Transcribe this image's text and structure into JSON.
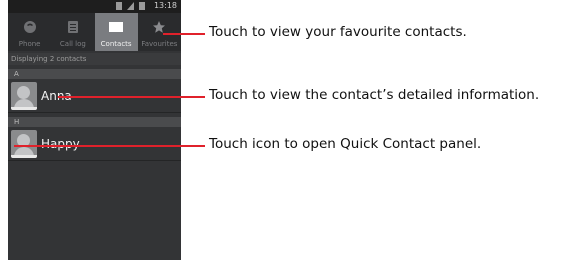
{
  "status": {
    "time": "13:18"
  },
  "tabs": [
    {
      "label": "Phone",
      "icon": "phone-icon",
      "active": false
    },
    {
      "label": "Call log",
      "icon": "call-log-icon",
      "active": false
    },
    {
      "label": "Contacts",
      "icon": "contacts-icon",
      "active": true
    },
    {
      "label": "Favourites",
      "icon": "star-icon",
      "active": false
    }
  ],
  "list": {
    "summary": "Displaying 2 contacts",
    "sections": [
      {
        "header": "A",
        "contacts": [
          {
            "name": "Anna"
          }
        ]
      },
      {
        "header": "H",
        "contacts": [
          {
            "name": "Happy"
          }
        ]
      }
    ]
  },
  "callouts": [
    "Touch to view your favourite contacts.",
    "Touch to view the contact’s detailed information.",
    "Touch icon to open Quick Contact panel."
  ],
  "colors": {
    "callout_line": "#e0212b",
    "phone_bg": "#333436",
    "active_tab": "#7a7c80"
  }
}
